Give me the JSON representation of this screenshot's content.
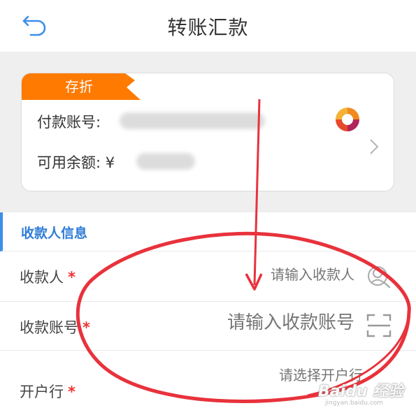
{
  "header": {
    "title": "转账汇款",
    "back_icon": "back-arrow-icon"
  },
  "account_card": {
    "tag": "存折",
    "payer_account_label": "付款账号:",
    "available_balance_label": "可用余额:",
    "currency_symbol": "¥",
    "colors": {
      "tag": "#ff7a00",
      "accent": "#3c8fe8"
    }
  },
  "payee_section": {
    "title": "收款人信息",
    "fields": [
      {
        "label": "收款人",
        "required_mark": "*",
        "placeholder": "请输入收款人",
        "icon": "contact-search-icon"
      },
      {
        "label": "收款账号",
        "required_mark": "*",
        "placeholder": "请输入收款账号",
        "icon": "scan-icon"
      },
      {
        "label": "开户行",
        "required_mark": "*",
        "placeholder": "请选择开户行",
        "icon": ""
      }
    ]
  },
  "watermark": {
    "brand": "Baidu 经验",
    "url": "jingyan.baidu.com"
  },
  "annotation": {
    "color": "#e8323c"
  }
}
